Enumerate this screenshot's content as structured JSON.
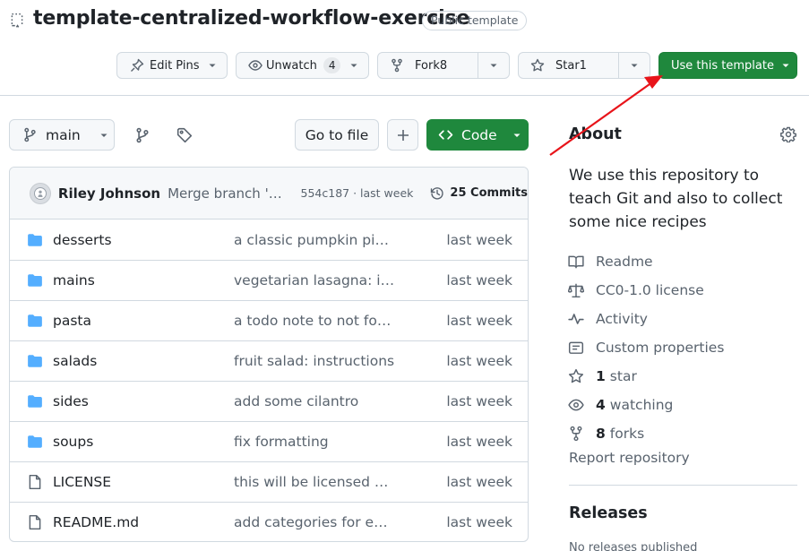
{
  "repo": {
    "title": "template-centralized-workflow-exercise",
    "visibility_badge": "Public template"
  },
  "actions": {
    "edit_pins": "Edit Pins",
    "unwatch": "Unwatch",
    "watch_count": "4",
    "fork": "Fork",
    "fork_count": "8",
    "star": "Star",
    "star_count": "1",
    "use_template": "Use this template"
  },
  "toolbar": {
    "branch": "main",
    "go_to_file": "Go to file",
    "code": "Code"
  },
  "commit": {
    "author": "Riley Johnson",
    "message": "Merge branch 'al...",
    "sha_time": "554c187 · last week",
    "count_label": "25 Commits"
  },
  "files": [
    {
      "name": "desserts",
      "type": "folder",
      "message": "a classic pumpkin pie r...",
      "date": "last week"
    },
    {
      "name": "mains",
      "type": "folder",
      "message": "vegetarian lasagna: ins...",
      "date": "last week"
    },
    {
      "name": "pasta",
      "type": "folder",
      "message": "a todo note to not forg...",
      "date": "last week"
    },
    {
      "name": "salads",
      "type": "folder",
      "message": "fruit salad: instructions",
      "date": "last week"
    },
    {
      "name": "sides",
      "type": "folder",
      "message": "add some cilantro",
      "date": "last week"
    },
    {
      "name": "soups",
      "type": "folder",
      "message": "fix formatting",
      "date": "last week"
    },
    {
      "name": "LICENSE",
      "type": "file",
      "message": "this will be licensed un...",
      "date": "last week"
    },
    {
      "name": "README.md",
      "type": "file",
      "message": "add categories for easi...",
      "date": "last week"
    }
  ],
  "about": {
    "title": "About",
    "description": "We use this repository to teach Git and also to collect some nice recipes",
    "readme": "Readme",
    "license": "CC0-1.0 license",
    "activity": "Activity",
    "custom_properties": "Custom properties",
    "stars_count": "1",
    "stars_label": "star",
    "watching_count": "4",
    "watching_label": "watching",
    "forks_count": "8",
    "forks_label": "forks",
    "report": "Report repository"
  },
  "releases": {
    "title": "Releases",
    "empty": "No releases published"
  },
  "colors": {
    "primary_green": "#1f883d",
    "border": "#d1d9e0",
    "muted_text": "#59636e",
    "folder_blue": "#54aeff",
    "annotation_arrow": "#e8141a"
  }
}
